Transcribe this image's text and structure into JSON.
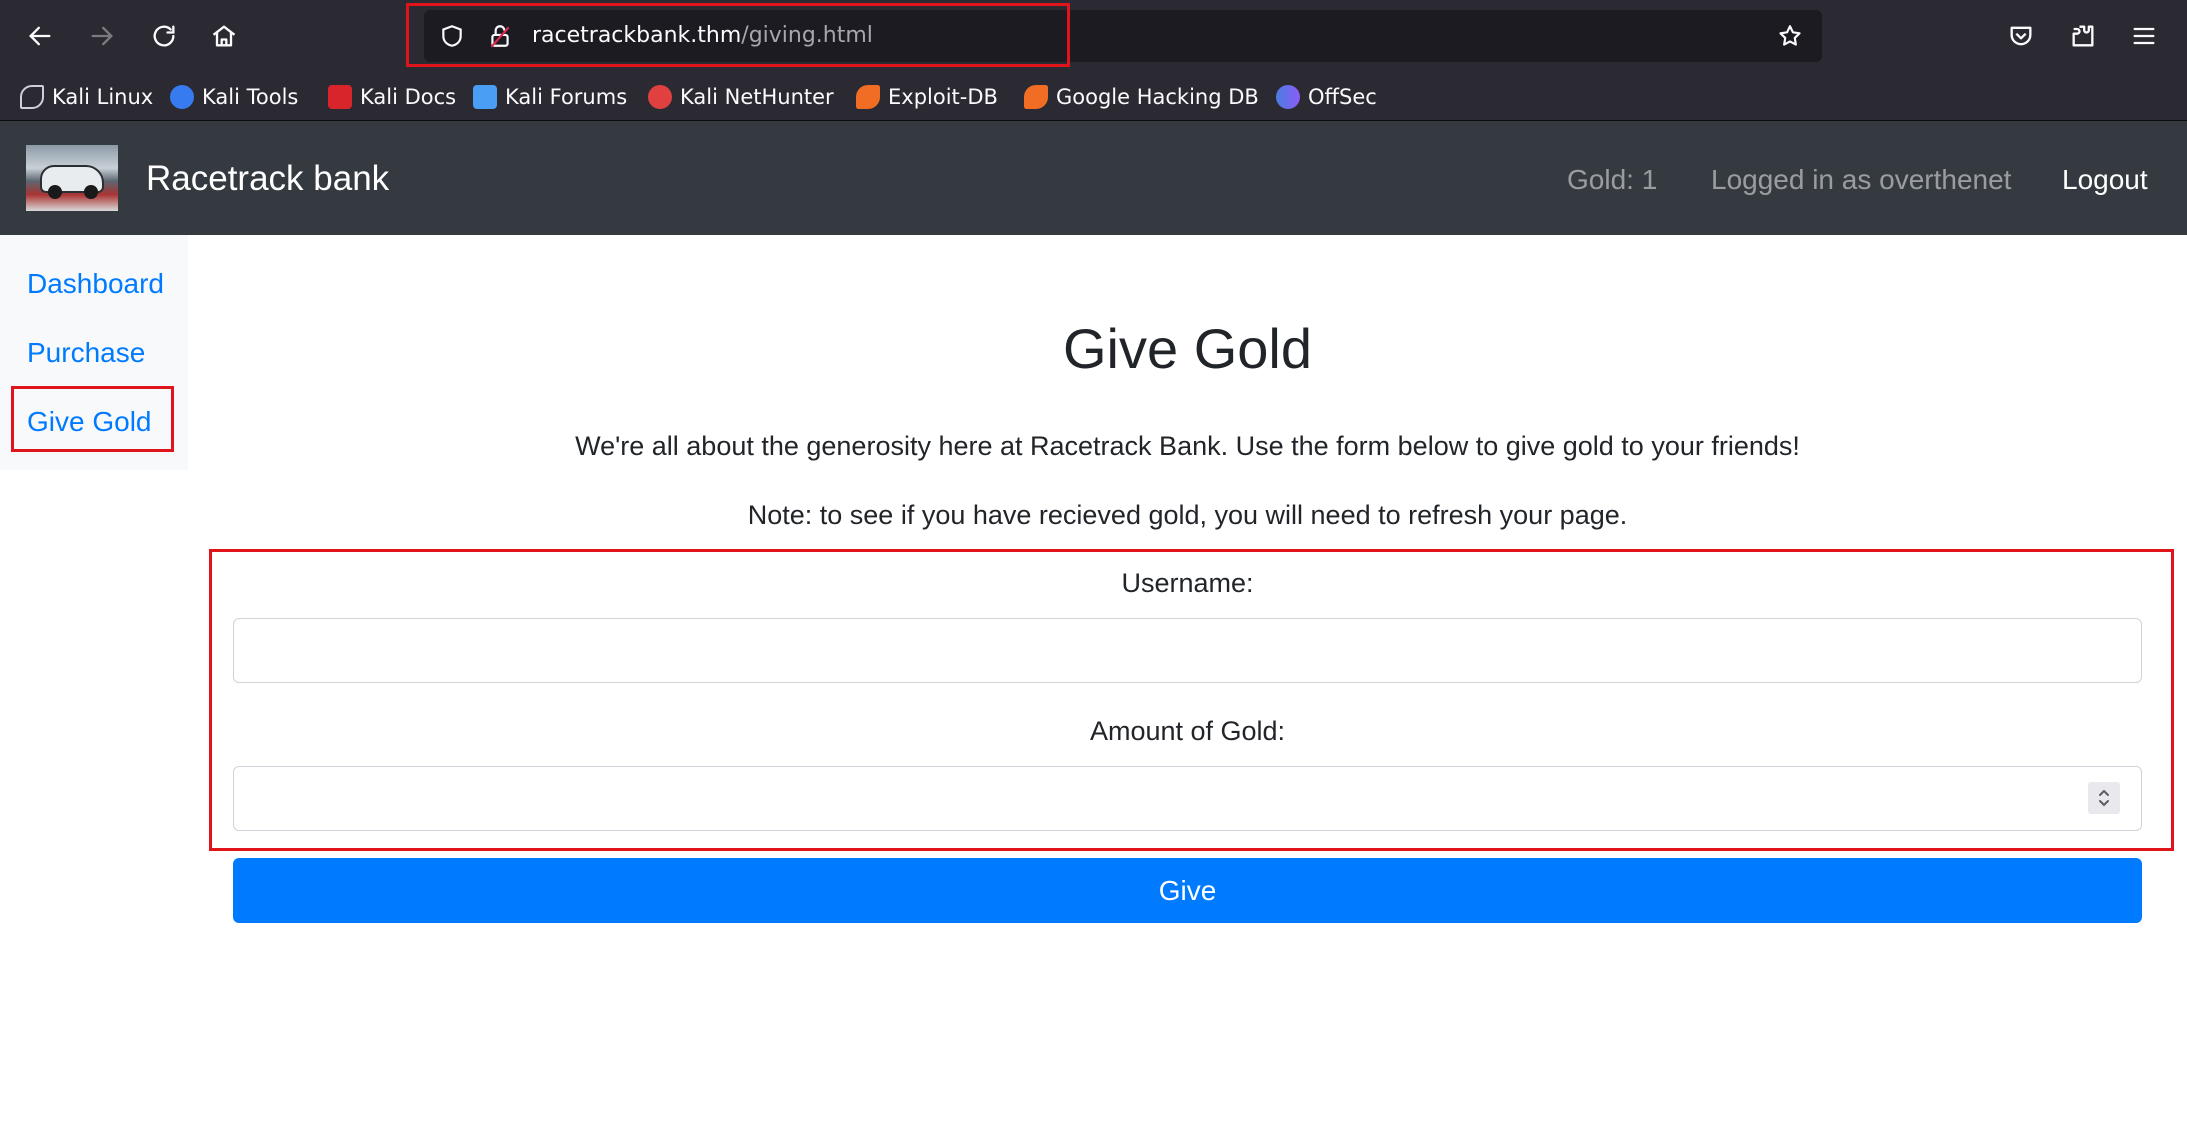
{
  "browser": {
    "url_host": "racetrackbank.thm",
    "url_path": "/giving.html",
    "bookmarks": [
      {
        "label": "Kali Linux",
        "icon": "kali-dragon-icon"
      },
      {
        "label": "Kali Tools",
        "icon": "kali-tools-icon"
      },
      {
        "label": "Kali Docs",
        "icon": "kali-docs-icon"
      },
      {
        "label": "Kali Forums",
        "icon": "kali-forums-icon"
      },
      {
        "label": "Kali NetHunter",
        "icon": "kali-nethunter-icon"
      },
      {
        "label": "Exploit-DB",
        "icon": "exploit-db-icon"
      },
      {
        "label": "Google Hacking DB",
        "icon": "google-hacking-db-icon"
      },
      {
        "label": "OffSec",
        "icon": "offsec-icon"
      }
    ]
  },
  "navbar": {
    "brand": "Racetrack bank",
    "gold": "Gold: 1",
    "user": "Logged in as overthenet",
    "logout": "Logout"
  },
  "sidebar": {
    "items": [
      {
        "label": "Dashboard"
      },
      {
        "label": "Purchase"
      },
      {
        "label": "Give Gold"
      }
    ]
  },
  "main": {
    "title": "Give Gold",
    "intro": "We're all about the generosity here at Racetrack Bank. Use the form below to give gold to your friends!",
    "note": "Note: to see if you have recieved gold, you will need to refresh your page.",
    "username_label": "Username:",
    "username_value": "",
    "amount_label": "Amount of Gold:",
    "amount_value": "",
    "give_button": "Give"
  },
  "colors": {
    "highlight": "#e0141b",
    "primary": "#007bff",
    "navbar_bg": "#343a40"
  }
}
